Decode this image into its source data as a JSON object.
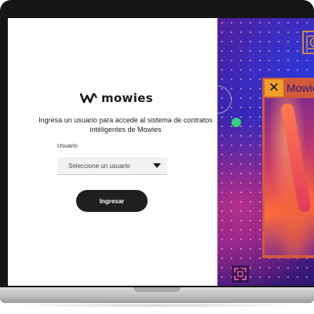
{
  "brand": {
    "name": "mowies",
    "logo_icon": "mowies-mark-icon"
  },
  "login": {
    "intro_text": "Ingresa un usuario para accede al sistema de contratos intéligentes de Mowies",
    "user_label": "Usuario",
    "user_select": {
      "placeholder": "Seleccione un usuario",
      "caret_icon": "caret-down-icon"
    },
    "submit_label": "Ingresar"
  },
  "artwork": {
    "badge_glyph": "✕",
    "title_text": "Mowie",
    "icons": [
      "play-frame-icon",
      "close-icon",
      "focus-frame-icon"
    ],
    "colors": {
      "accent_orange": "#f0a028",
      "accent_green": "#2fd37a",
      "purple": "#3a1fa8"
    }
  },
  "colors": {
    "button_bg": "#1f1f1f",
    "button_text": "#ffffff",
    "text": "#222222"
  }
}
